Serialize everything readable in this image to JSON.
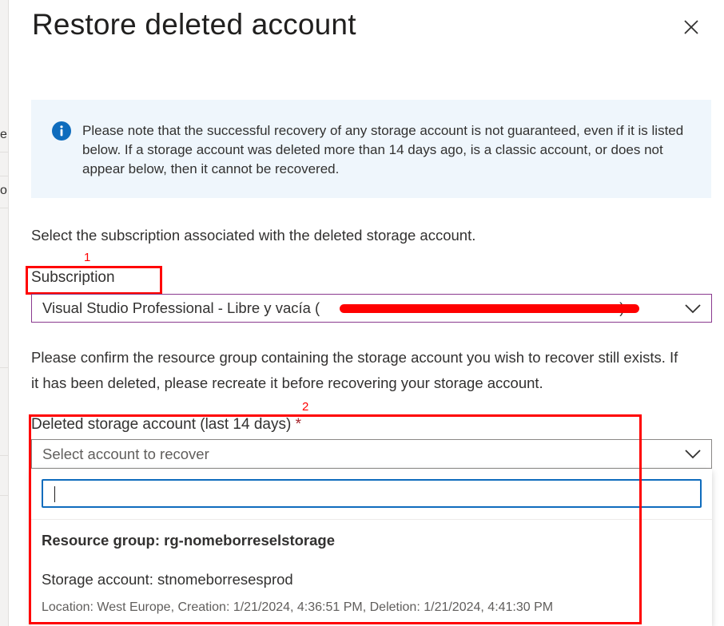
{
  "backdrop": {
    "fragment_1": "e",
    "fragment_2": "o"
  },
  "dialog": {
    "title": "Restore deleted account",
    "close_icon": "close-icon"
  },
  "info": {
    "icon": "info-icon",
    "text": "Please note that the successful recovery of any storage account is not guaranteed, even if it is listed below. If a storage account was deleted more than 14 days ago, is a classic account, or does not appear below, then it cannot be recovered."
  },
  "subscription_section": {
    "instruction": "Select the subscription associated with the deleted storage account.",
    "label": "Subscription",
    "annotation_number": "1",
    "selected_value": "Visual Studio Professional - Libre y vacía (",
    "value_close": ")"
  },
  "resource_group_note": "Please confirm the resource group containing the storage account you wish to recover still exists. If it has been deleted, please recreate it before recovering your storage account.",
  "deleted_account_section": {
    "label": "Deleted storage account (last 14 days)",
    "required_marker": "*",
    "annotation_number": "2",
    "placeholder": "Select account to recover",
    "search_value": "",
    "group_header": "Resource group: rg-nomeborreselstorage",
    "option": {
      "name": "Storage account: stnomeborresesprod",
      "details": "Location: West Europe, Creation: 1/21/2024, 4:36:51 PM, Deletion: 1/21/2024, 4:41:30 PM"
    }
  },
  "colors": {
    "annotation": "#ff0000",
    "info_background": "#eff6fc",
    "info_icon": "#0f6cbd",
    "focus_border": "#0f6cbd"
  }
}
